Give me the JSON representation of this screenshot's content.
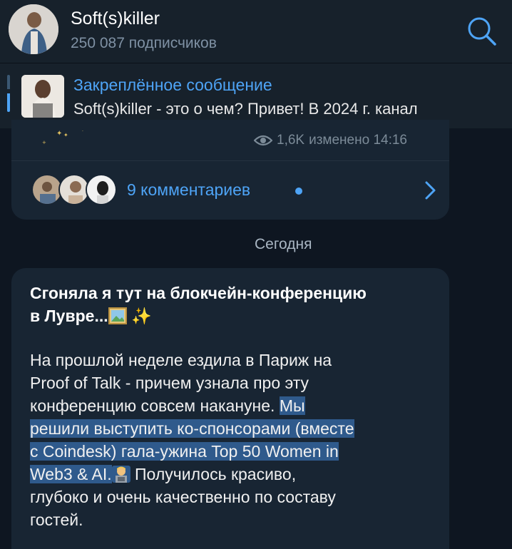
{
  "header": {
    "title": "Soft(s)killer",
    "subscribers": "250 087 подписчиков"
  },
  "pinned": {
    "label": "Закреплённое сообщение",
    "text": "Soft(s)killer - это о чем?   Привет! В 2024 г. канал"
  },
  "previous_post": {
    "views": "1,6K",
    "edited_time": "изменено 14:16",
    "comments_label": "9 комментариев"
  },
  "date_separator": "Сегодня",
  "post": {
    "title_line1": "Сгоняла я тут на блокчейн-конференцию",
    "title_line2": "в Лувре...",
    "body_l1": "На прошлой неделе ездила в Париж на",
    "body_l2": "Proof of Talk - причем узнала про эту",
    "body_l3_plain": "конференцию совсем накануне. ",
    "body_l3_hl": "Мы",
    "body_l4_hl": "решили выступить ко-спонсорами (вместе",
    "body_l5_hl": "с Coindesk) гала-ужина Top 50 Women in",
    "body_l6_hl": "Web3 & AI.",
    "body_l6_plain": "  Получилось красиво,",
    "body_l7": "глубоко и очень качественно по составу",
    "body_l8": "гостей."
  },
  "colors": {
    "background": "#0e1621",
    "panel": "#17212b",
    "bubble": "#182533",
    "accent": "#4ea4f6",
    "highlight": "#2f5a8c"
  },
  "icons": [
    "search-icon",
    "eye-icon",
    "chevron-right-icon",
    "picture-emoji",
    "sparkles-emoji",
    "hacker-emoji"
  ]
}
